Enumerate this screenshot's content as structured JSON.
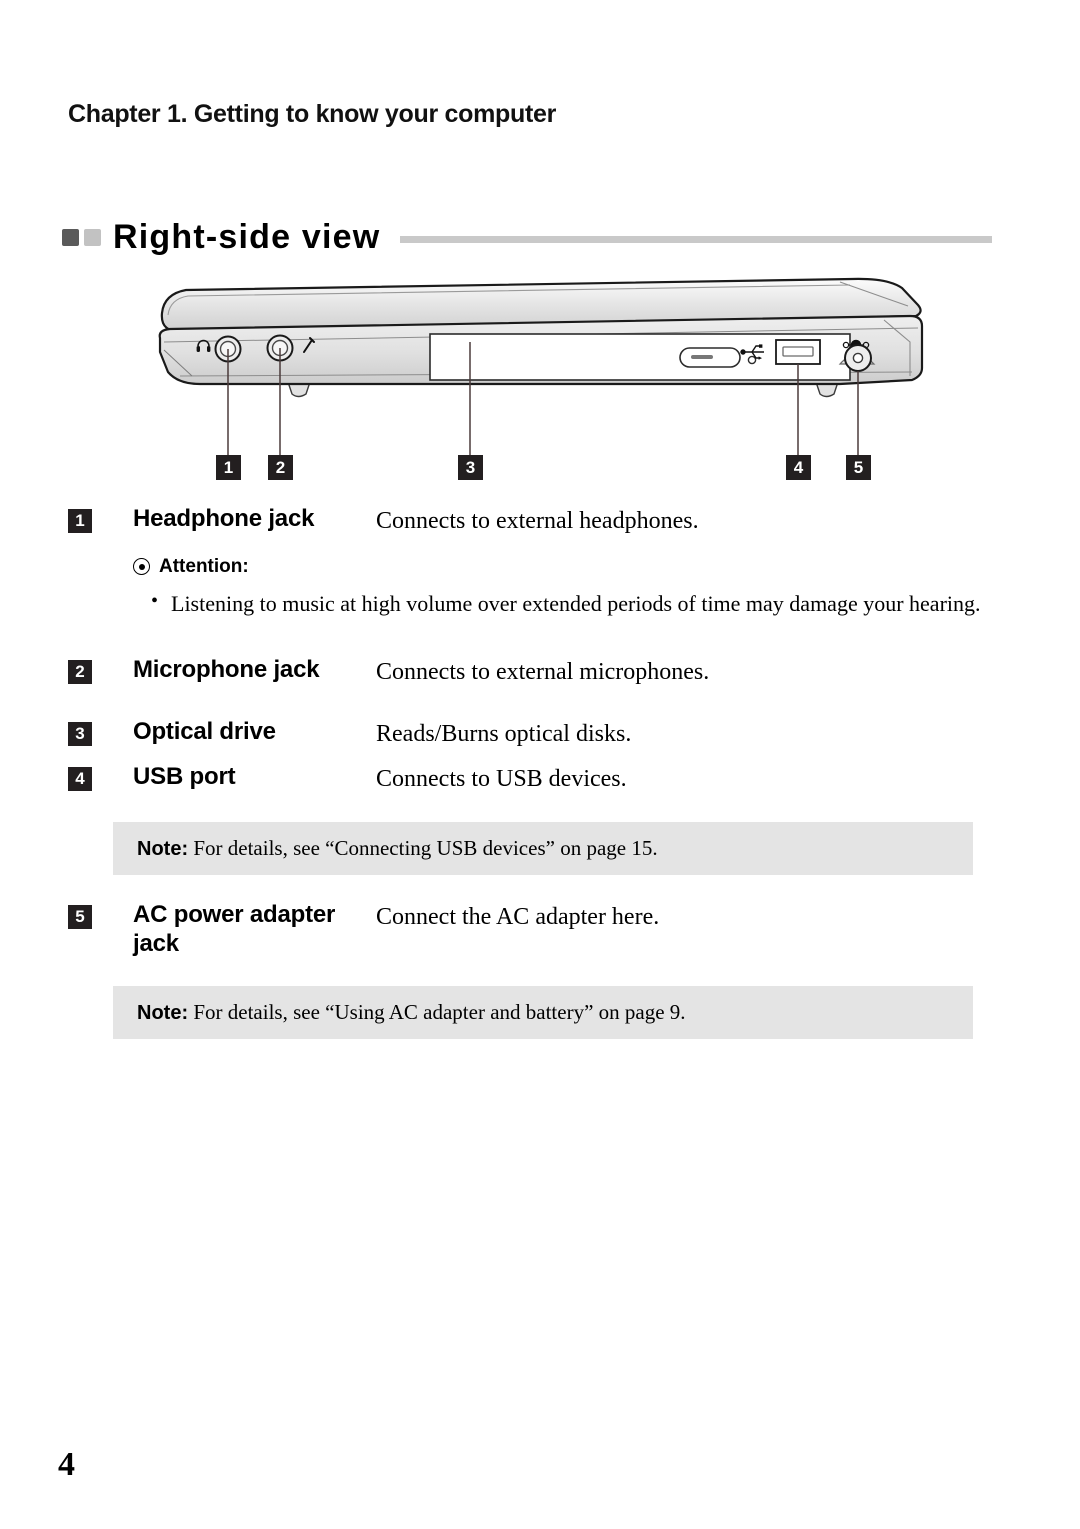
{
  "header": {
    "chapter": "Chapter 1. Getting to know your computer"
  },
  "section": {
    "title": "Right-side view",
    "marker_dark_color": "#5a5a5a",
    "marker_light_color": "#c2c2c2",
    "rule_color": "#c9c9c9"
  },
  "figure": {
    "name": "laptop-right-side-view-diagram",
    "callouts": [
      {
        "number": "1",
        "target": "headphone-jack"
      },
      {
        "number": "2",
        "target": "microphone-jack"
      },
      {
        "number": "3",
        "target": "optical-drive"
      },
      {
        "number": "4",
        "target": "usb-port"
      },
      {
        "number": "5",
        "target": "ac-power-adapter-jack"
      }
    ],
    "port_icons": [
      "headphone-icon",
      "microphone-icon",
      "usb-icon",
      "power-plug-icon"
    ]
  },
  "items": [
    {
      "number": "1",
      "label": "Headphone jack",
      "description": "Connects to external headphones."
    },
    {
      "number": "2",
      "label": "Microphone jack",
      "description": "Connects to external microphones."
    },
    {
      "number": "3",
      "label": "Optical drive",
      "description": "Reads/Burns optical disks."
    },
    {
      "number": "4",
      "label": "USB port",
      "description": "Connects to USB devices."
    },
    {
      "number": "5",
      "label": "AC power adapter jack",
      "description": "Connect the AC adapter here."
    }
  ],
  "attention": {
    "heading": "Attention:",
    "bullets": [
      "Listening to music at high volume over extended periods of time may damage your hearing."
    ]
  },
  "notes": [
    {
      "prefix": "Note:",
      "text": " For details, see “Connecting USB devices” on page 15.",
      "background": "#e4e4e4"
    },
    {
      "prefix": "Note:",
      "text": " For details, see “Using AC adapter and battery” on page 9.",
      "background": "#e4e4e4"
    }
  ],
  "footer": {
    "page_number": "4"
  }
}
